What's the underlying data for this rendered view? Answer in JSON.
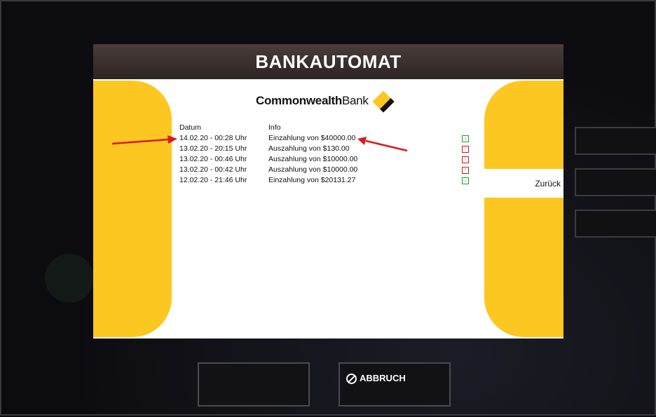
{
  "header": {
    "title": "BANKAUTOMAT"
  },
  "logo": {
    "brand_bold": "Commonwealth",
    "brand_regular": "Bank"
  },
  "transactions": {
    "columns": [
      "Datum",
      "Info"
    ],
    "rows": [
      {
        "date": "14.02.20 - 00:28 Uhr",
        "info": "Einzahlung von $40000.00",
        "type": "in"
      },
      {
        "date": "13.02.20 - 20:15 Uhr",
        "info": "Auszahlung von $130.00",
        "type": "out"
      },
      {
        "date": "13.02.20 - 00:46 Uhr",
        "info": "Auszahlung von $10000.00",
        "type": "out"
      },
      {
        "date": "13.02.20 - 00:42 Uhr",
        "info": "Auszahlung von $10000.00",
        "type": "out"
      },
      {
        "date": "12.02.20 - 21:46 Uhr",
        "info": "Einzahlung von $20131.27",
        "type": "in"
      }
    ]
  },
  "side_menu": {
    "back_label": "Zurück"
  },
  "footer": {
    "cancel_label": "ABBRUCH"
  },
  "colors": {
    "brand_yellow": "#fdc722",
    "deposit": "#1ea11e",
    "withdrawal": "#c31e1e"
  }
}
